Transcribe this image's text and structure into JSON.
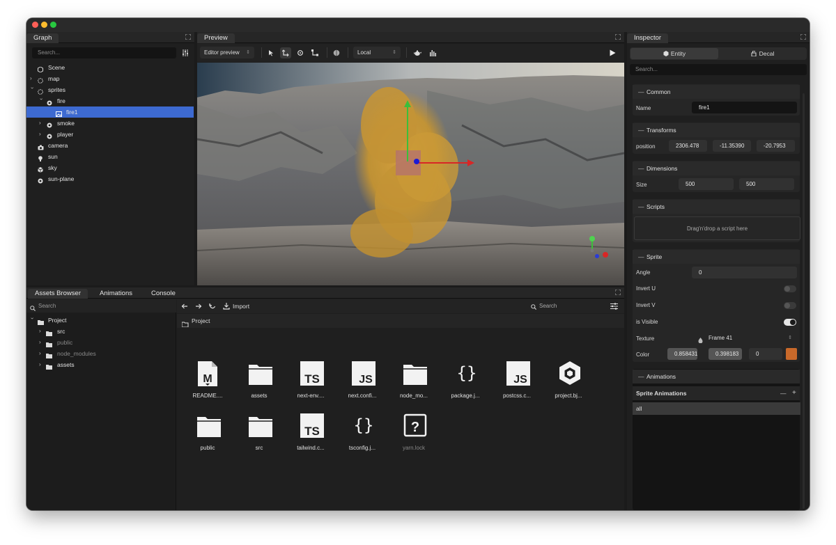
{
  "graph": {
    "title": "Graph",
    "search_placeholder": "Search...",
    "tree": [
      {
        "label": "Scene",
        "icon": "scene-icon"
      },
      {
        "label": "map",
        "icon": "group-icon"
      },
      {
        "label": "sprites",
        "icon": "group-icon"
      },
      {
        "label": "fire",
        "icon": "sprite-group-icon"
      },
      {
        "label": "fire1",
        "icon": "image-icon"
      },
      {
        "label": "smoke",
        "icon": "sprite-group-icon"
      },
      {
        "label": "player",
        "icon": "sprite-group-icon"
      },
      {
        "label": "camera",
        "icon": "camera-icon"
      },
      {
        "label": "sun",
        "icon": "bulb-icon"
      },
      {
        "label": "sky",
        "icon": "cube-icon"
      },
      {
        "label": "sun-plane",
        "icon": "sprite-group-icon"
      }
    ]
  },
  "preview": {
    "title": "Preview",
    "mode_select": "Editor preview",
    "space_select": "Local"
  },
  "inspector": {
    "title": "Inspector",
    "tabs": {
      "entity": "Entity",
      "decal": "Decal"
    },
    "search_placeholder": "Search...",
    "common": {
      "title": "Common",
      "name_label": "Name",
      "name_value": "fire1"
    },
    "transforms": {
      "title": "Transforms",
      "position_label": "position",
      "x": "2306.478",
      "y": "-11.35390",
      "z": "-20.7953"
    },
    "dimensions": {
      "title": "Dimensions",
      "size_label": "Size",
      "w": "500",
      "h": "500"
    },
    "scripts": {
      "title": "Scripts",
      "drop_text": "Drag'n'drop a script here"
    },
    "sprite": {
      "title": "Sprite",
      "angle_label": "Angle",
      "angle_value": "0",
      "invert_u_label": "Invert U",
      "invert_u": false,
      "invert_v_label": "Invert V",
      "invert_v": false,
      "visible_label": "is Visible",
      "visible": true,
      "texture_label": "Texture",
      "texture_value": "Frame 41",
      "color_label": "Color",
      "color_r": "0.858431",
      "color_g": "0.398183",
      "color_b": "0",
      "color_swatch": "#c9692a"
    },
    "animations": {
      "title": "Animations",
      "list_title": "Sprite Animations",
      "items": [
        "all"
      ]
    }
  },
  "bottom": {
    "tabs": [
      "Assets Browser",
      "Animations",
      "Console"
    ],
    "search_placeholder": "Search",
    "tree": [
      {
        "label": "Project"
      },
      {
        "label": "src"
      },
      {
        "label": "public"
      },
      {
        "label": "node_modules"
      },
      {
        "label": "assets"
      }
    ],
    "toolbar": {
      "import_label": "Import",
      "search_placeholder": "Search"
    },
    "breadcrumb": "Project",
    "files": [
      {
        "name": "README....",
        "type": "markdown"
      },
      {
        "name": "assets",
        "type": "folder"
      },
      {
        "name": "next-env....",
        "type": "ts"
      },
      {
        "name": "next.confi...",
        "type": "js"
      },
      {
        "name": "node_mo...",
        "type": "folder"
      },
      {
        "name": "package.j...",
        "type": "json"
      },
      {
        "name": "postcss.c...",
        "type": "js"
      },
      {
        "name": "project.bj...",
        "type": "babylon"
      },
      {
        "name": "public",
        "type": "folder"
      },
      {
        "name": "src",
        "type": "folder"
      },
      {
        "name": "tailwind.c...",
        "type": "ts"
      },
      {
        "name": "tsconfig.j...",
        "type": "json"
      },
      {
        "name": "yarn.lock",
        "type": "unknown"
      }
    ]
  },
  "colors": {
    "accent": "#3d6ad1",
    "bg": "#1b1b1b",
    "panel": "#262626"
  }
}
